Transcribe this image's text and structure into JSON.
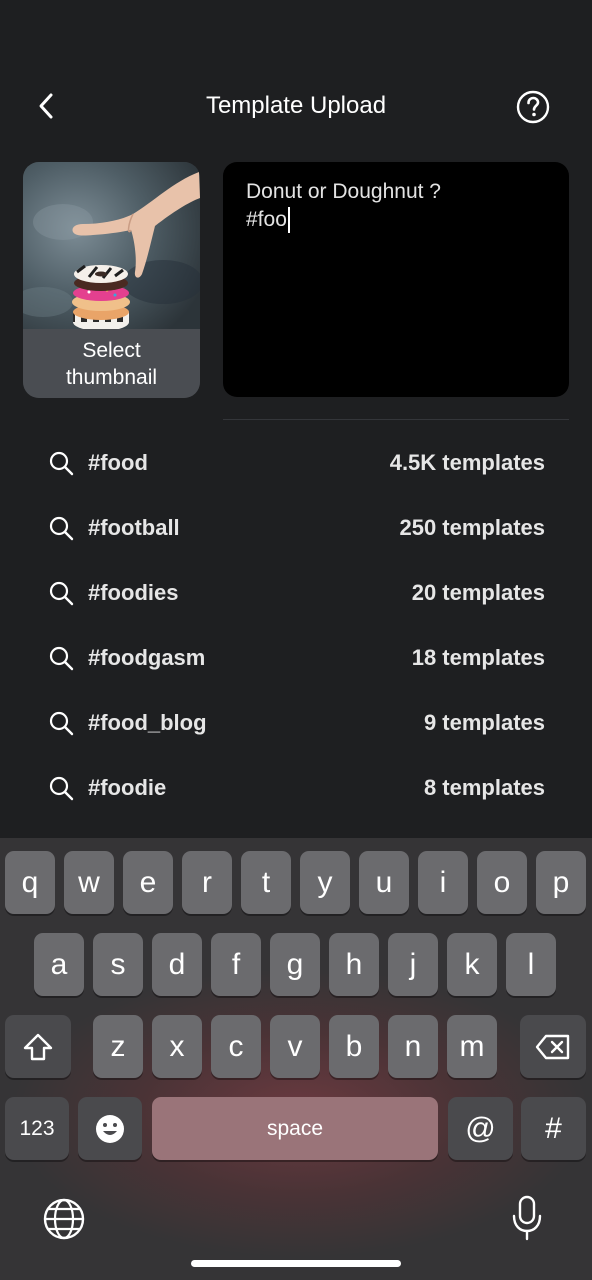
{
  "header": {
    "title": "Template Upload"
  },
  "thumbnail": {
    "label": "Select\nthumbnail"
  },
  "caption": {
    "line1": "Donut or Doughnut ?",
    "line2": "#foo"
  },
  "suggestions": [
    {
      "tag": "#food",
      "count": "4.5K templates"
    },
    {
      "tag": "#football",
      "count": "250 templates"
    },
    {
      "tag": "#foodies",
      "count": "20 templates"
    },
    {
      "tag": "#foodgasm",
      "count": "18 templates"
    },
    {
      "tag": "#food_blog",
      "count": "9 templates"
    },
    {
      "tag": "#foodie",
      "count": "8 templates"
    }
  ],
  "keyboard": {
    "row1": [
      "q",
      "w",
      "e",
      "r",
      "t",
      "y",
      "u",
      "i",
      "o",
      "p"
    ],
    "row2": [
      "a",
      "s",
      "d",
      "f",
      "g",
      "h",
      "j",
      "k",
      "l"
    ],
    "row3": [
      "z",
      "x",
      "c",
      "v",
      "b",
      "n",
      "m"
    ],
    "numbers_key": "123",
    "space_key": "space",
    "at_key": "@",
    "hash_key": "#"
  }
}
